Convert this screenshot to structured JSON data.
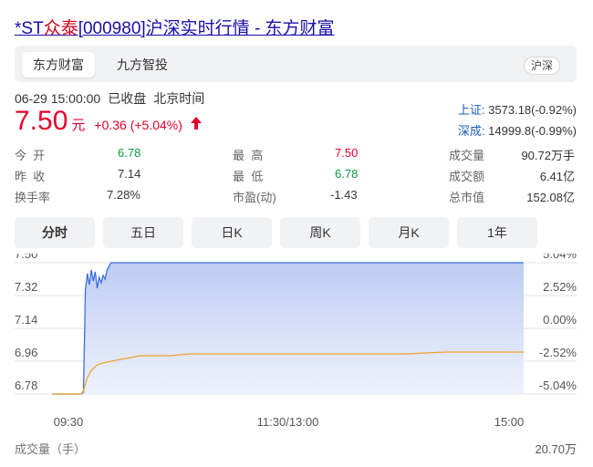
{
  "page": {
    "title_prefix": "*ST",
    "title_highlight": "众泰",
    "title_suffix": "[000980]沪深实时行情 - 东方财富"
  },
  "tabs": [
    {
      "label": "东方财富",
      "active": true
    },
    {
      "label": "九方智投",
      "active": false
    }
  ],
  "market_badge": "沪深",
  "quote": {
    "datetime": "06-29 15:00:00",
    "status": "已收盘",
    "timezone": "北京时间",
    "price": "7.50",
    "unit": "元",
    "change": "+0.36 (+5.04%)",
    "direction": "up"
  },
  "indices": [
    {
      "name": "上证:",
      "value": "3573.18(-0.92%)"
    },
    {
      "name": "深成:",
      "value": "14999.8(-0.99%)"
    }
  ],
  "stats": {
    "open": {
      "label": "今  开",
      "value": "6.78"
    },
    "prev_close": {
      "label": "昨  收",
      "value": "7.14"
    },
    "turnover_rate": {
      "label": "换手率",
      "value": "7.28%"
    },
    "high": {
      "label": "最  高",
      "value": "7.50"
    },
    "low": {
      "label": "最  低",
      "value": "6.78"
    },
    "pe": {
      "label": "市盈(动)",
      "value": "-1.43"
    },
    "volume": {
      "label": "成交量",
      "value": "90.72万手"
    },
    "amount": {
      "label": "成交额",
      "value": "6.41亿"
    },
    "market_cap": {
      "label": "总市值",
      "value": "152.08亿"
    }
  },
  "period_tabs": [
    {
      "label": "分时",
      "active": true
    },
    {
      "label": "五日",
      "active": false
    },
    {
      "label": "日K",
      "active": false
    },
    {
      "label": "周K",
      "active": false
    },
    {
      "label": "月K",
      "active": false
    },
    {
      "label": "1年",
      "active": false
    }
  ],
  "chart_data": {
    "type": "area",
    "title": "",
    "x_tick_labels": [
      "09:30",
      "11:30/13:00",
      "15:00"
    ],
    "y_tick_labels_left": [
      "7.50",
      "7.32",
      "7.14",
      "6.96",
      "6.78"
    ],
    "y_tick_labels_right": [
      "5.04%",
      "2.52%",
      "0.00%",
      "-2.52%",
      "-5.04%"
    ],
    "ylim": [
      6.78,
      7.5
    ],
    "grid": true,
    "x_minutes_total": 240,
    "series": [
      {
        "kind": "price",
        "color": "#3b6fe0",
        "fill": "#c7d3f5",
        "points": [
          [
            0,
            6.78
          ],
          [
            15,
            6.78
          ],
          [
            16,
            6.79
          ],
          [
            17,
            7.35
          ],
          [
            18,
            7.44
          ],
          [
            19,
            7.38
          ],
          [
            20,
            7.46
          ],
          [
            21,
            7.4
          ],
          [
            22,
            7.45
          ],
          [
            23,
            7.36
          ],
          [
            24,
            7.42
          ],
          [
            25,
            7.39
          ],
          [
            26,
            7.43
          ],
          [
            27,
            7.41
          ],
          [
            28,
            7.46
          ],
          [
            29,
            7.48
          ],
          [
            30,
            7.5
          ],
          [
            40,
            7.5
          ],
          [
            120,
            7.5
          ],
          [
            240,
            7.5
          ]
        ]
      },
      {
        "kind": "average",
        "color": "#f0a030",
        "points": [
          [
            0,
            6.78
          ],
          [
            15,
            6.78
          ],
          [
            16,
            6.8
          ],
          [
            18,
            6.87
          ],
          [
            20,
            6.91
          ],
          [
            23,
            6.94
          ],
          [
            26,
            6.95
          ],
          [
            30,
            6.96
          ],
          [
            35,
            6.97
          ],
          [
            40,
            6.98
          ],
          [
            45,
            6.99
          ],
          [
            60,
            6.99
          ],
          [
            70,
            7.0
          ],
          [
            120,
            7.0
          ],
          [
            180,
            7.0
          ],
          [
            200,
            7.01
          ],
          [
            240,
            7.01
          ]
        ]
      }
    ]
  },
  "volume_section": {
    "label": "成交量（手）",
    "max_value": "20.70万"
  }
}
